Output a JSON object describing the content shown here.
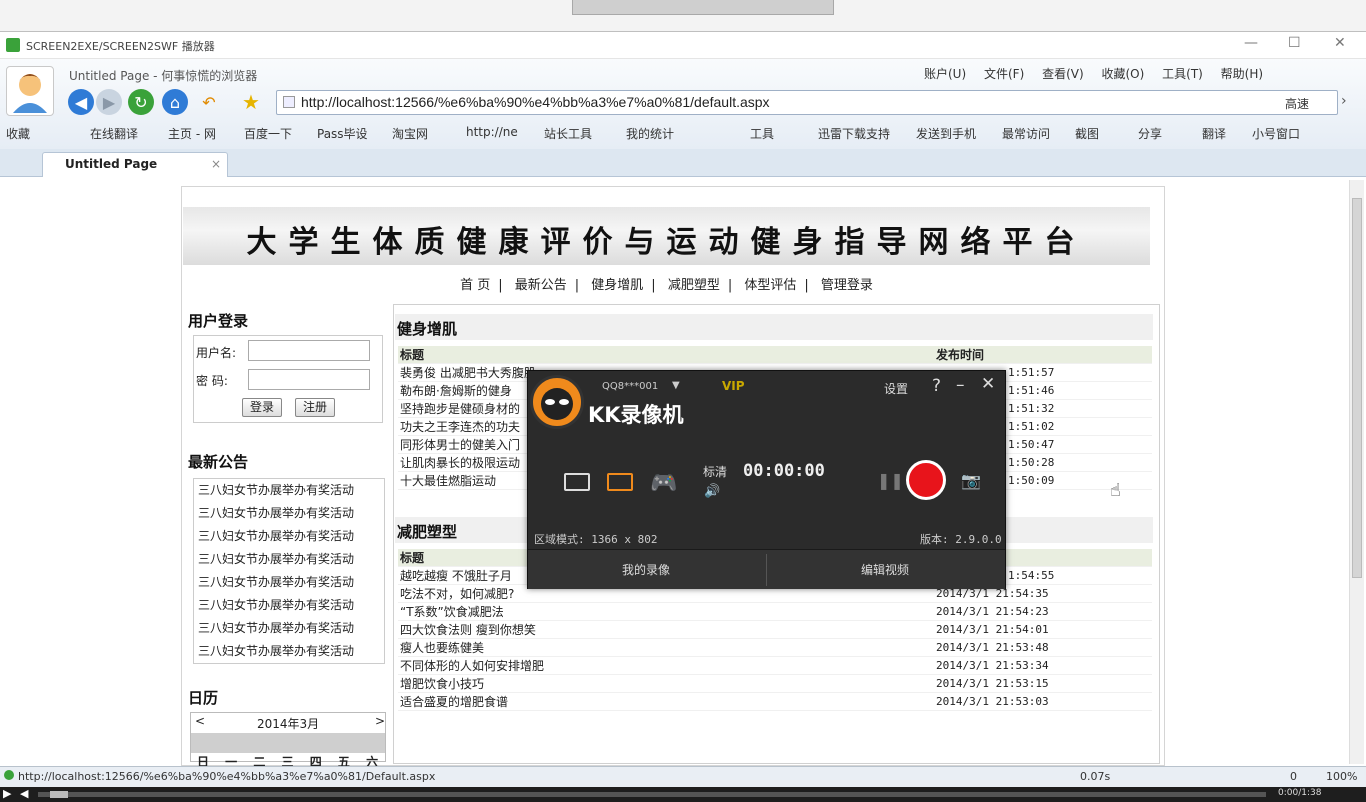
{
  "outer_window": {
    "title": "SCREEN2EXE/SCREEN2SWF 播放器",
    "min": "—",
    "max": "☐",
    "close": "✕"
  },
  "browser": {
    "title": "Untitled Page - 何事惊慌的浏览器",
    "menu": [
      "账户(U)",
      "文件(F)",
      "查看(V)",
      "收藏(O)",
      "工具(T)",
      "帮助(H)"
    ],
    "address": "http://localhost:12566/%e6%ba%90%e4%bb%a3%e7%a0%81/default.aspx",
    "speed_label": "高速",
    "favorites_left": [
      "收藏",
      "在线翻译",
      "主页 - 网",
      "百度一下",
      "Pass毕设",
      "淘宝网",
      "http://ne",
      "站长工具",
      "我的统计"
    ],
    "favorites_right": [
      "工具",
      "迅雷下载支持",
      "发送到手机",
      "最常访问",
      "截图",
      "分享",
      "翻译",
      "小号窗口"
    ],
    "tab_title": "Untitled Page",
    "status_url": "http://localhost:12566/%e6%ba%90%e4%bb%a3%e7%a0%81/Default.aspx",
    "status_time": "0.07s",
    "status_count": "0",
    "zoom": "100%"
  },
  "site": {
    "banner_title": "大学生体质健康评价与运动健身指导网络平台",
    "nav": [
      "首 页",
      "最新公告",
      "健身增肌",
      "减肥塑型",
      "体型评估",
      "管理登录"
    ],
    "nav_sep": "|",
    "login": {
      "title": "用户登录",
      "user_label": "用户名:",
      "pwd_label": "密 码:",
      "login_btn": "登录",
      "register_btn": "注册"
    },
    "notice": {
      "title": "最新公告",
      "items": [
        "三八妇女节办展举办有奖活动",
        "三八妇女节办展举办有奖活动",
        "三八妇女节办展举办有奖活动",
        "三八妇女节办展举办有奖活动",
        "三八妇女节办展举办有奖活动",
        "三八妇女节办展举办有奖活动",
        "三八妇女节办展举办有奖活动",
        "三八妇女节办展举办有奖活动"
      ]
    },
    "calendar": {
      "title": "日历",
      "month": "2014年3月",
      "prev": "<",
      "next": ">",
      "weekdays": "日 一 二 三 四 五 六"
    },
    "fitness": {
      "title": "健身增肌",
      "col_title": "标题",
      "col_time": "发布时间",
      "rows": [
        {
          "t": "裴勇俊 出减肥书大秀腹肌",
          "d": "1:51:57"
        },
        {
          "t": "勒布朗·詹姆斯的健身",
          "d": "1:51:46"
        },
        {
          "t": "坚持跑步是健硕身材的",
          "d": "1:51:32"
        },
        {
          "t": "功夫之王李连杰的功夫",
          "d": "1:51:02"
        },
        {
          "t": "同形体男士的健美入门",
          "d": "1:50:47"
        },
        {
          "t": "让肌肉暴长的极限运动",
          "d": "1:50:28"
        },
        {
          "t": "十大最佳燃脂运动",
          "d": "1:50:09"
        }
      ]
    },
    "slimming": {
      "title": "减肥塑型",
      "col_title": "标题",
      "rows": [
        {
          "t": "越吃越瘦 不饿肚子月",
          "d": "1:54:55"
        },
        {
          "t": "吃法不对，如何减肥?",
          "d": "2014/3/1 21:54:35"
        },
        {
          "t": "“T系数”饮食减肥法",
          "d": "2014/3/1 21:54:23"
        },
        {
          "t": "四大饮食法则 瘦到你想笑",
          "d": "2014/3/1 21:54:01"
        },
        {
          "t": "瘦人也要练健美",
          "d": "2014/3/1 21:53:48"
        },
        {
          "t": "不同体形的人如何安排增肥",
          "d": "2014/3/1 21:53:34"
        },
        {
          "t": "增肥饮食小技巧",
          "d": "2014/3/1 21:53:15"
        },
        {
          "t": "适合盛夏的增肥食谱",
          "d": "2014/3/1 21:53:03"
        }
      ]
    }
  },
  "kk": {
    "account": "QQ8***001",
    "vip": "VIP",
    "settings": "设置",
    "help": "?",
    "app_name": "KK录像机",
    "quality": "标清",
    "timer": "00:00:00",
    "area": "区域模式: 1366 x 802",
    "version": "版本: 2.9.0.0",
    "my_videos": "我的录像",
    "edit_video": "编辑视频"
  },
  "player": {
    "time": "0:00/1:38"
  },
  "colors": {
    "record": "#e8141b",
    "kk_bg": "#2b2b2b",
    "kk_accent": "#f08a1c"
  }
}
